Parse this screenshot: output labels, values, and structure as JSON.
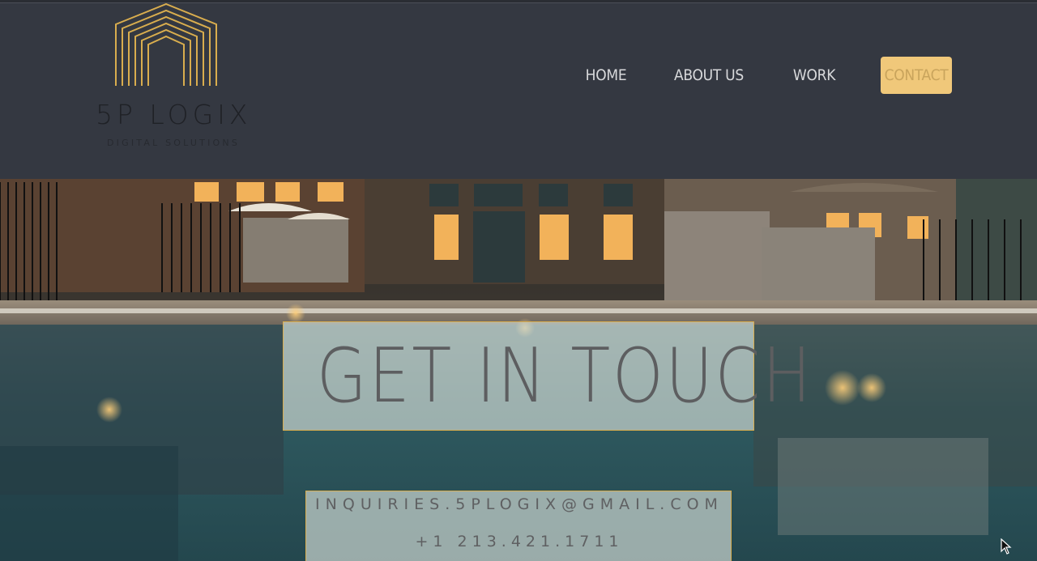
{
  "brand": {
    "name": "5P LOGIX",
    "tagline": "DIGITAL SOLUTIONS",
    "icon": "house-lines-logo",
    "accent_color": "#d9ad4e"
  },
  "nav": {
    "items": [
      {
        "label": "HOME",
        "active": false
      },
      {
        "label": "ABOUT US",
        "active": false
      },
      {
        "label": "WORK",
        "active": false
      },
      {
        "label": "CONTACT",
        "active": true
      }
    ],
    "active_color": "#f0c87a"
  },
  "hero": {
    "background": "pool-and-lodge-photo",
    "title": "GET IN TOUCH",
    "email": "INQUIRIES.5PLOGIX@GMAIL.COM",
    "phone": "+1 213.421.1711"
  },
  "colors": {
    "header_bg": "#343841",
    "box_fill": "rgba(200,210,205,0.72)"
  }
}
